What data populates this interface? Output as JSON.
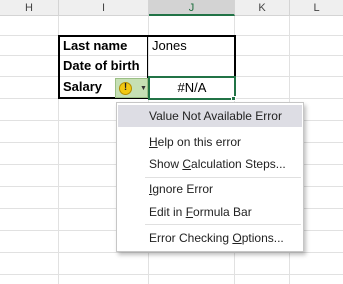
{
  "columns": [
    "H",
    "I",
    "J",
    "K",
    "L"
  ],
  "cells": {
    "last_name_label": "Last name",
    "last_name_value": "Jones",
    "dob_label": "Date of birth",
    "salary_label": "Salary",
    "salary_value": "#N/A"
  },
  "smart_tag": {
    "icon": "warning-icon",
    "glyph": "!",
    "arrow": "▼"
  },
  "menu": {
    "items": [
      {
        "pre": "Value Not Available Error",
        "ul": "",
        "post": ""
      },
      {
        "pre": "",
        "ul": "H",
        "post": "elp on this error"
      },
      {
        "pre": "Show ",
        "ul": "C",
        "post": "alculation Steps..."
      },
      {
        "pre": "",
        "ul": "I",
        "post": "gnore Error"
      },
      {
        "pre": "Edit in ",
        "ul": "F",
        "post": "ormula Bar"
      },
      {
        "pre": "Error Checking ",
        "ul": "O",
        "post": "ptions..."
      }
    ]
  },
  "colors": {
    "accent": "#217346",
    "smart_tag_bg": "#c6e0b4",
    "highlight": "#dddde4"
  }
}
